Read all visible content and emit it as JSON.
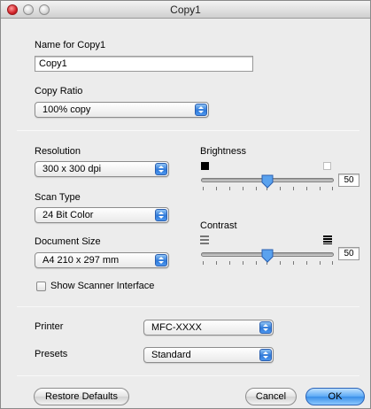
{
  "window": {
    "title": "Copy1"
  },
  "name_section": {
    "label": "Name for Copy1",
    "value": "Copy1"
  },
  "copy_ratio": {
    "label": "Copy Ratio",
    "selected": "100% copy"
  },
  "resolution": {
    "label": "Resolution",
    "selected": "300 x 300 dpi"
  },
  "scan_type": {
    "label": "Scan Type",
    "selected": "24 Bit Color"
  },
  "document_size": {
    "label": "Document Size",
    "selected": "A4  210 x 297 mm"
  },
  "brightness": {
    "label": "Brightness",
    "value": "50"
  },
  "contrast": {
    "label": "Contrast",
    "value": "50"
  },
  "scanner_interface": {
    "label": "Show Scanner Interface",
    "checked": false
  },
  "printer": {
    "label": "Printer",
    "selected": "MFC-XXXX"
  },
  "presets": {
    "label": "Presets",
    "selected": "Standard"
  },
  "buttons": {
    "restore": "Restore Defaults",
    "cancel": "Cancel",
    "ok": "OK"
  }
}
